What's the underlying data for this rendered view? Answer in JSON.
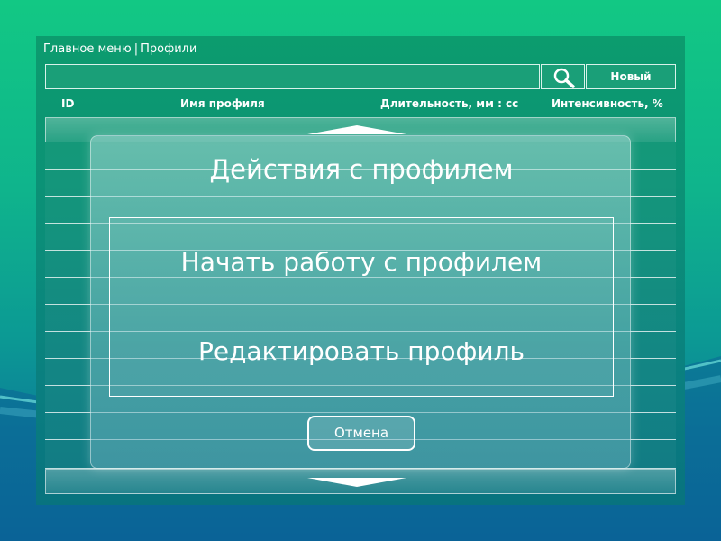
{
  "breadcrumb": {
    "main_menu": "Главное меню",
    "separator": "|",
    "current": "Профили"
  },
  "toolbar": {
    "search_value": "",
    "search_icon": "search-icon",
    "new_label": "Новый"
  },
  "table": {
    "columns": [
      "ID",
      "Имя профиля",
      "Длительность, мм : сс",
      "Интенсивность, %"
    ],
    "rows": []
  },
  "dialog": {
    "title": "Действия с профилем",
    "start_label": "Начать работу с профилем",
    "edit_label": "Редактировать профиль",
    "cancel_label": "Отмена"
  },
  "colors": {
    "background_top": "#12c884",
    "background_bottom": "#0a6a98",
    "panel": "#0b8f78",
    "border": "#ffffff"
  }
}
